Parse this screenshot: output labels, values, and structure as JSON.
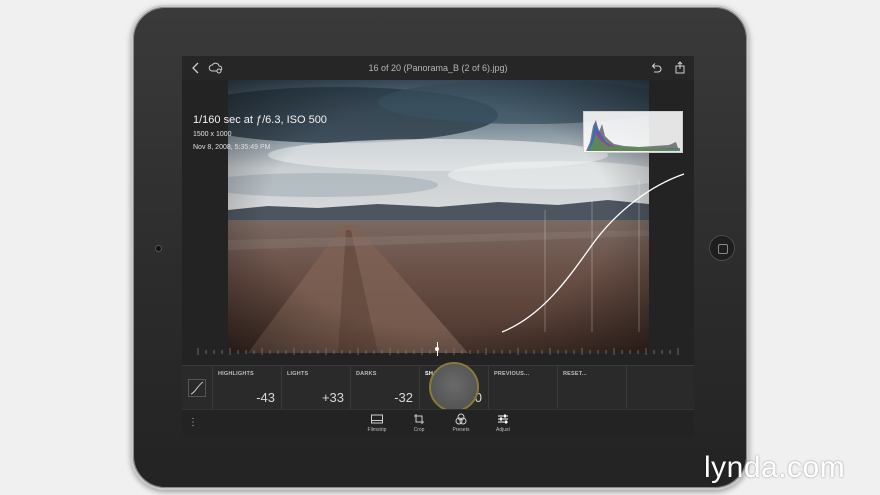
{
  "app": {
    "file_title": "16 of 20 (Panorama_B (2 of 6).jpg)"
  },
  "photo_info": {
    "exposure": "1/160 sec at ƒ/6.3, ISO 500",
    "dimensions": "1500 x 1000",
    "date": "Nov 8, 2008, 5:35:49 PM"
  },
  "adjustments": [
    {
      "label": "HIGHLIGHTS",
      "value": "-43"
    },
    {
      "label": "LIGHTS",
      "value": "+33"
    },
    {
      "label": "DARKS",
      "value": "-32"
    },
    {
      "label": "SHADOWS",
      "value": "0"
    },
    {
      "label": "PREVIOUS...",
      "value": ""
    },
    {
      "label": "RESET...",
      "value": ""
    }
  ],
  "toolbar": {
    "filmstrip": "Filmstrip",
    "crop": "Crop",
    "presets": "Presets",
    "adjust": "Adjust"
  },
  "icons": {
    "back": "chevron-left-icon",
    "cloud": "cloud-sync-icon",
    "undo": "undo-icon",
    "share": "share-icon",
    "curve_tool": "tone-curve-icon",
    "more": "more-vertical-icon"
  },
  "watermark": "lynda.com",
  "colors": {
    "accent_ring": "#8a7a3a",
    "screen_bg": "#1f1f1f"
  }
}
